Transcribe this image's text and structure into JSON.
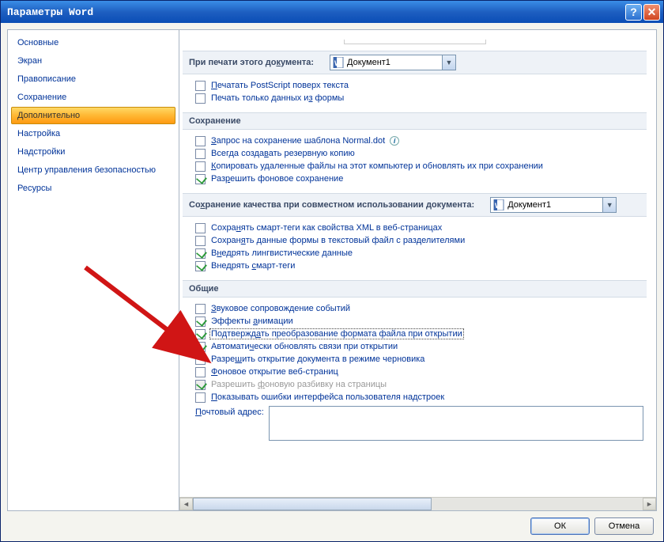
{
  "titlebar": {
    "title": "Параметры Word"
  },
  "sidebar": {
    "items": [
      {
        "label": "Основные"
      },
      {
        "label": "Экран"
      },
      {
        "label": "Правописание"
      },
      {
        "label": "Сохранение"
      },
      {
        "label": "Дополнительно",
        "selected": true
      },
      {
        "label": "Настройка"
      },
      {
        "label": "Надстройки"
      },
      {
        "label": "Центр управления безопасностью"
      },
      {
        "label": "Ресурсы"
      }
    ]
  },
  "sections": {
    "print_doc": {
      "title_pre": "При печати этого до",
      "title_u": "к",
      "title_post": "умента:",
      "sel_value": "Документ1",
      "opts": [
        {
          "pre": "",
          "u": "П",
          "post": "ечатать PostScript поверх текста",
          "checked": false
        },
        {
          "pre": "Печать только данных и",
          "u": "з",
          "post": " формы",
          "checked": false
        }
      ]
    },
    "save": {
      "title": "Сохранение",
      "opts": [
        {
          "pre": "",
          "u": "З",
          "post": "апрос на сохранение шаблона Normal.dot",
          "checked": false,
          "info": true
        },
        {
          "pre": "Всегда созда",
          "u": "в",
          "post": "ать резервную копию",
          "checked": false
        },
        {
          "pre": "",
          "u": "К",
          "post": "опировать удаленные файлы на этот компьютер и обновлять их при сохранении",
          "checked": false
        },
        {
          "pre": "Раз",
          "u": "р",
          "post": "ешить фоновое сохранение",
          "checked": true
        }
      ]
    },
    "quality": {
      "title_pre": "Со",
      "title_u": "х",
      "title_post": "ранение качества при совместном использовании документа:",
      "sel_value": "Документ1",
      "opts": [
        {
          "pre": "Сохра",
          "u": "н",
          "post": "ять смарт-теги как свойства XML в веб-страницах",
          "checked": false
        },
        {
          "pre": "Сохран",
          "u": "я",
          "post": "ть данные формы в текстовый файл с разделителями",
          "checked": false
        },
        {
          "pre": "В",
          "u": "н",
          "post": "едрять лингвистические данные",
          "checked": true
        },
        {
          "pre": "Внедрять ",
          "u": "с",
          "post": "март-теги",
          "checked": true
        }
      ]
    },
    "general": {
      "title": "Общие",
      "opts": [
        {
          "pre": "",
          "u": "З",
          "post": "вуковое сопровождение событий",
          "checked": false
        },
        {
          "pre": "Эффекты ",
          "u": "а",
          "post": "нимации",
          "checked": true
        },
        {
          "pre": "Подтвержд",
          "u": "а",
          "post": "ть преобразование формата файла при открытии",
          "checked": true,
          "focused": true
        },
        {
          "pre": "Автомати",
          "u": "ч",
          "post": "ески обновлять связи при открытии",
          "checked": true
        },
        {
          "pre": "Разре",
          "u": "ш",
          "post": "ить открытие документа в режиме черновика",
          "checked": false
        },
        {
          "pre": "",
          "u": "Ф",
          "post": "оновое открытие веб-страниц",
          "checked": false
        },
        {
          "pre": "Разрешить ",
          "u": "ф",
          "post": "оновую разбивку на страницы",
          "checked": true,
          "disabled": true
        },
        {
          "pre": "",
          "u": "П",
          "post": "оказывать ошибки интерфейса пользователя надстроек",
          "checked": false
        }
      ],
      "address_pre": "",
      "address_u": "П",
      "address_post": "очтовый адрес:"
    }
  },
  "buttons": {
    "ok": "ОК",
    "cancel": "Отмена"
  }
}
